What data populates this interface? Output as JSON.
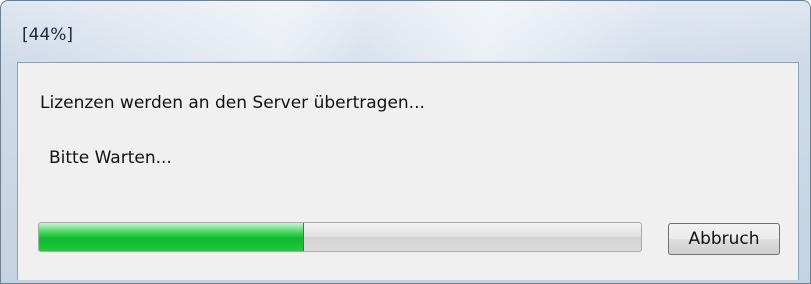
{
  "window": {
    "title": "[44%]"
  },
  "dialog": {
    "message": "Lizenzen werden an den Server übertragen...",
    "subtext": "Bitte Warten...",
    "progress": {
      "percent": 44,
      "fill_color": "#18c03a"
    },
    "cancel_label": "Abbruch"
  }
}
